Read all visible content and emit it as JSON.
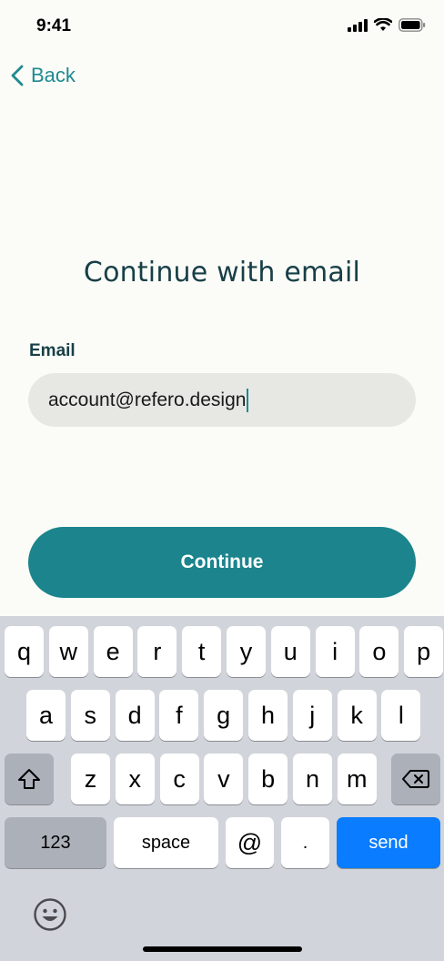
{
  "status_bar": {
    "time": "9:41"
  },
  "nav": {
    "back_label": "Back"
  },
  "page": {
    "title": "Continue with email"
  },
  "form": {
    "email_label": "Email",
    "email_value": "account@refero.design",
    "continue_label": "Continue"
  },
  "keyboard": {
    "row1": [
      "q",
      "w",
      "e",
      "r",
      "t",
      "y",
      "u",
      "i",
      "o",
      "p"
    ],
    "row2": [
      "a",
      "s",
      "d",
      "f",
      "g",
      "h",
      "j",
      "k",
      "l"
    ],
    "row3": [
      "z",
      "x",
      "c",
      "v",
      "b",
      "n",
      "m"
    ],
    "numbers_label": "123",
    "space_label": "space",
    "at_label": "@",
    "dot_label": ".",
    "send_label": "send"
  },
  "colors": {
    "accent": "#1b848c",
    "title": "#173f47",
    "background": "#fbfbf7",
    "send_key": "#0a7cff"
  }
}
